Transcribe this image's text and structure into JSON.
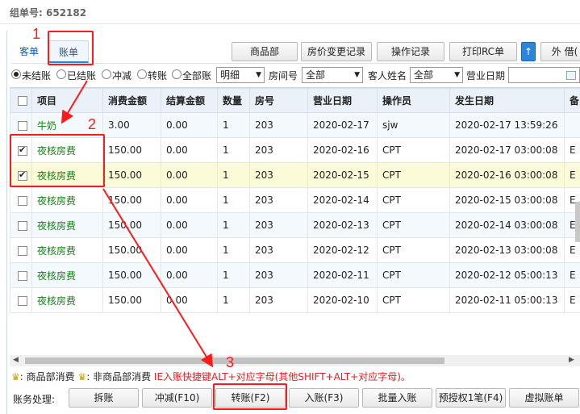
{
  "header": {
    "order_label": "组单号:",
    "order_no": "652182"
  },
  "tabs": [
    {
      "label": "客单"
    },
    {
      "label": "账单"
    }
  ],
  "toolbar": {
    "buttons": [
      "商品部",
      "房价变更记录",
      "操作记录",
      "打印RC单",
      "外 借("
    ],
    "up_icon": "↑"
  },
  "filters": {
    "radios": [
      "未结账",
      "已结账",
      "冲减",
      "转账",
      "全部账"
    ],
    "view_select": "明细",
    "room_label": "房间号",
    "room_select": "全部",
    "guest_label": "客人姓名",
    "guest_select": "全部",
    "date_label": "营业日期"
  },
  "table": {
    "columns": [
      "项目",
      "消费金额",
      "结算金额",
      "数量",
      "房号",
      "营业日期",
      "操作员",
      "发生日期",
      "备"
    ],
    "rows": [
      {
        "item": "牛奶",
        "amount": "3.00",
        "settle": "0.00",
        "qty": "1",
        "room": "203",
        "biz_date": "2020-02-17",
        "operator": "sjw",
        "occur": "2020-02-17 13:59:26",
        "extra": "",
        "checked": false
      },
      {
        "item": "夜核房费",
        "amount": "150.00",
        "settle": "0.00",
        "qty": "1",
        "room": "203",
        "biz_date": "2020-02-16",
        "operator": "CPT",
        "occur": "2020-02-17 03:00:08",
        "extra": "E",
        "checked": true
      },
      {
        "item": "夜核房费",
        "amount": "150.00",
        "settle": "0.00",
        "qty": "1",
        "room": "203",
        "biz_date": "2020-02-15",
        "operator": "CPT",
        "occur": "2020-02-16 03:00:08",
        "extra": "E",
        "checked": true
      },
      {
        "item": "夜核房费",
        "amount": "150.00",
        "settle": "0.00",
        "qty": "1",
        "room": "203",
        "biz_date": "2020-02-14",
        "operator": "CPT",
        "occur": "2020-02-15 03:00:08",
        "extra": "E",
        "checked": false
      },
      {
        "item": "夜核房费",
        "amount": "150.00",
        "settle": "0.00",
        "qty": "1",
        "room": "203",
        "biz_date": "2020-02-13",
        "operator": "CPT",
        "occur": "2020-02-14 03:00:08",
        "extra": "E",
        "checked": false
      },
      {
        "item": "夜核房费",
        "amount": "150.00",
        "settle": "0.00",
        "qty": "1",
        "room": "203",
        "biz_date": "2020-02-12",
        "operator": "CPT",
        "occur": "2020-02-13 03:00:08",
        "extra": "E",
        "checked": false
      },
      {
        "item": "夜核房费",
        "amount": "150.00",
        "settle": "0.00",
        "qty": "1",
        "room": "203",
        "biz_date": "2020-02-11",
        "operator": "CPT",
        "occur": "2020-02-12 05:00:13",
        "extra": "E",
        "checked": false
      },
      {
        "item": "夜核房费",
        "amount": "150.00",
        "settle": "0.00",
        "qty": "1",
        "room": "203",
        "biz_date": "2020-02-10",
        "operator": "CPT",
        "occur": "2020-02-11 05:00:13",
        "extra": "E",
        "checked": false
      }
    ]
  },
  "legend": {
    "crown1": "♛",
    "text1": ": 商品部消费",
    "crown2": "♛",
    "text2": ": 非商品部消费",
    "hint": "IE入账快捷键ALT+对应字母(其他SHIFT+ALT+对应字母)。"
  },
  "bottom": {
    "label": "账务处理:",
    "buttons": [
      "拆账",
      "冲减(F10)",
      "转账(F2)",
      "入账(F3)",
      "批量入账",
      "预授权1笔(F4)",
      "虚拟账单"
    ]
  },
  "annotations": {
    "n1": "1",
    "n2": "2",
    "n3": "3",
    "color": "#ff1a1a"
  }
}
